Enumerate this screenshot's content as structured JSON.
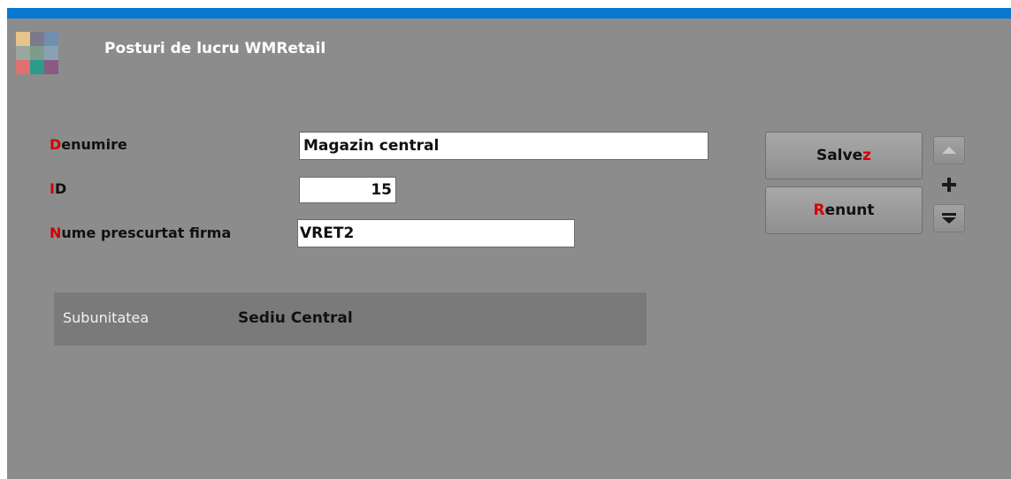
{
  "window": {
    "title": "Posturi de lucru WMRetail"
  },
  "form": {
    "denumire": {
      "hotkey": "D",
      "rest": "enumire",
      "value": "Magazin central"
    },
    "id": {
      "hotkey": "I",
      "rest": "D",
      "value": "15"
    },
    "nume": {
      "hotkey": "N",
      "rest": "ume prescurtat firma",
      "value": "VRET2"
    }
  },
  "buttons": {
    "save": {
      "prefix": "Salve",
      "hotkey": "z"
    },
    "cancel": {
      "hotkey": "R",
      "rest": "enunt"
    }
  },
  "subunit": {
    "label": "Subunitatea",
    "value": "Sediu Central"
  },
  "colors": {
    "accent": "#0a78d2",
    "hotkey": "#d40000",
    "background": "#8c8c8c"
  }
}
